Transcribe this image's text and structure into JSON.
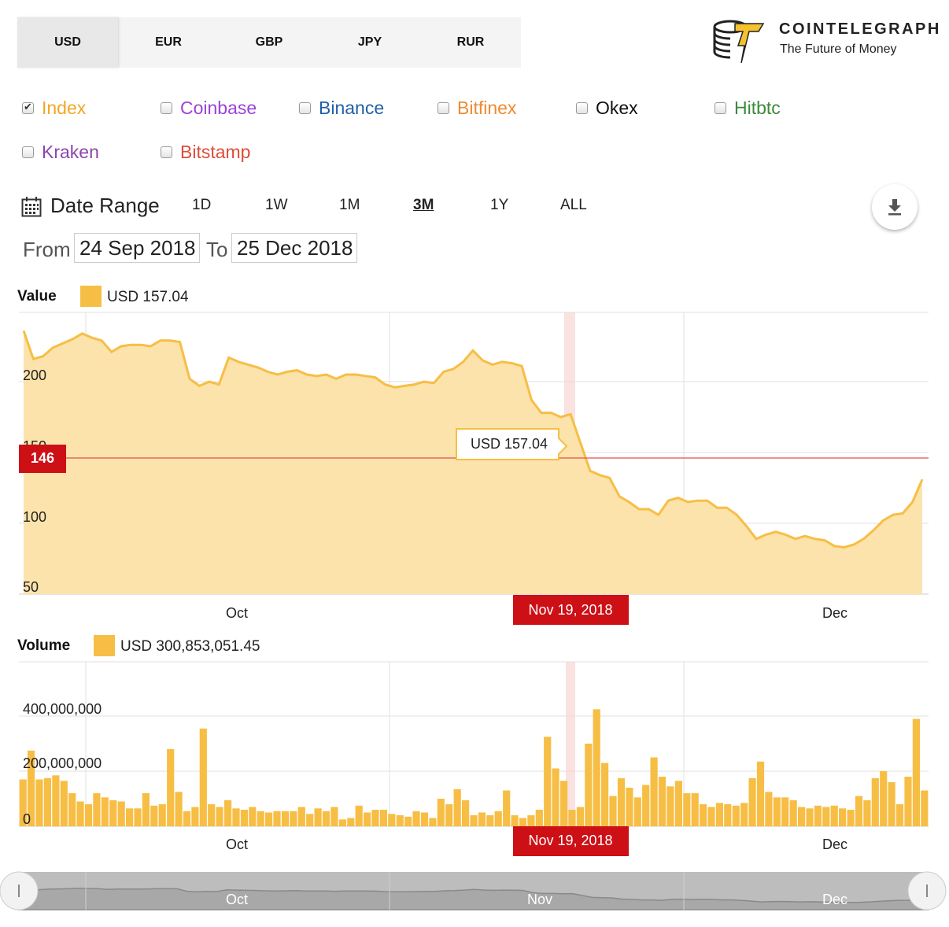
{
  "currencies": {
    "tabs": [
      "USD",
      "EUR",
      "GBP",
      "JPY",
      "RUR"
    ],
    "active": "USD"
  },
  "logo": {
    "title": "COINTELEGRAPH",
    "subtitle": "The Future of Money",
    "icon": "coin-stack-lightning-icon"
  },
  "exchanges": [
    {
      "label": "Index",
      "checked": true,
      "color": "#f5a623"
    },
    {
      "label": "Coinbase",
      "checked": false,
      "color": "#9b42d8"
    },
    {
      "label": "Binance",
      "checked": false,
      "color": "#1f5fa8"
    },
    {
      "label": "Bitfinex",
      "checked": false,
      "color": "#f08a30"
    },
    {
      "label": "Okex",
      "checked": false,
      "color": "#111111"
    },
    {
      "label": "Hitbtc",
      "checked": false,
      "color": "#3b8a3b"
    },
    {
      "label": "Kraken",
      "checked": false,
      "color": "#8e44ad"
    },
    {
      "label": "Bitstamp",
      "checked": false,
      "color": "#e04b3a"
    }
  ],
  "date_range": {
    "label": "Date Range",
    "buttons": [
      "1D",
      "1W",
      "1M",
      "3M",
      "1Y",
      "ALL"
    ],
    "active": "3M",
    "from_label": "From",
    "from_value": "24 Sep 2018",
    "to_label": "To",
    "to_value": "25 Dec 2018"
  },
  "value_legend": {
    "title": "Value",
    "text": "USD  157.04"
  },
  "volume_legend": {
    "title": "Volume",
    "text": "USD  300,853,051.45"
  },
  "colors": {
    "series": "#f7be45",
    "area_fill": "#fbe3ab",
    "marker_red": "#cc1016",
    "highlight_band": "#f7d5d3"
  },
  "chart_data": [
    {
      "type": "area",
      "title": "Value",
      "ylim": [
        50,
        250
      ],
      "y_ticks": [
        50,
        100,
        150,
        200
      ],
      "x_ticks": [
        "Oct",
        "Dec"
      ],
      "grid": true,
      "series": [
        {
          "name": "Index",
          "x": [
            "2018-09-24",
            "2018-09-25",
            "2018-09-26",
            "2018-09-27",
            "2018-09-28",
            "2018-09-29",
            "2018-09-30",
            "2018-10-01",
            "2018-10-02",
            "2018-10-03",
            "2018-10-04",
            "2018-10-05",
            "2018-10-06",
            "2018-10-07",
            "2018-10-08",
            "2018-10-09",
            "2018-10-10",
            "2018-10-11",
            "2018-10-12",
            "2018-10-13",
            "2018-10-14",
            "2018-10-15",
            "2018-10-16",
            "2018-10-17",
            "2018-10-18",
            "2018-10-19",
            "2018-10-20",
            "2018-10-21",
            "2018-10-22",
            "2018-10-23",
            "2018-10-24",
            "2018-10-25",
            "2018-10-26",
            "2018-10-27",
            "2018-10-28",
            "2018-10-29",
            "2018-10-30",
            "2018-10-31",
            "2018-11-01",
            "2018-11-02",
            "2018-11-03",
            "2018-11-04",
            "2018-11-05",
            "2018-11-06",
            "2018-11-07",
            "2018-11-08",
            "2018-11-09",
            "2018-11-10",
            "2018-11-11",
            "2018-11-12",
            "2018-11-13",
            "2018-11-14",
            "2018-11-15",
            "2018-11-16",
            "2018-11-17",
            "2018-11-18",
            "2018-11-19",
            "2018-11-20",
            "2018-11-21",
            "2018-11-22",
            "2018-11-23",
            "2018-11-24",
            "2018-11-25",
            "2018-11-26",
            "2018-11-27",
            "2018-11-28",
            "2018-11-29",
            "2018-11-30",
            "2018-12-01",
            "2018-12-02",
            "2018-12-03",
            "2018-12-04",
            "2018-12-05",
            "2018-12-06",
            "2018-12-07",
            "2018-12-08",
            "2018-12-09",
            "2018-12-10",
            "2018-12-11",
            "2018-12-12",
            "2018-12-13",
            "2018-12-14",
            "2018-12-15",
            "2018-12-16",
            "2018-12-17",
            "2018-12-18",
            "2018-12-19",
            "2018-12-20",
            "2018-12-21",
            "2018-12-22",
            "2018-12-23",
            "2018-12-24",
            "2018-12-25"
          ],
          "y": [
            236,
            216,
            218,
            224,
            227,
            230,
            234,
            231,
            229,
            221,
            225,
            226,
            226,
            225,
            229,
            229,
            228,
            202,
            197,
            200,
            198,
            217,
            214,
            212,
            210,
            207,
            205,
            207,
            208,
            205,
            204,
            205,
            202,
            205,
            205,
            204,
            203,
            198,
            196,
            197,
            198,
            200,
            199,
            207,
            209,
            214,
            222,
            215,
            212,
            214,
            213,
            211,
            187,
            178,
            178,
            175,
            177,
            157,
            137,
            134,
            132,
            119,
            115,
            110,
            110,
            106,
            116,
            118,
            115,
            116,
            116,
            111,
            111,
            106,
            98,
            89,
            92,
            94,
            92,
            89,
            91,
            89,
            88,
            84,
            83,
            85,
            89,
            95,
            102,
            106,
            107,
            115,
            131
          ]
        }
      ]
    },
    {
      "type": "bar",
      "title": "Volume",
      "ylim": [
        0,
        450000000
      ],
      "y_ticks": [
        0,
        200000000,
        400000000
      ],
      "x_ticks": [
        "Oct",
        "Dec"
      ],
      "grid": true,
      "series": [
        {
          "name": "Index",
          "values": [
            170000000,
            275000000,
            170000000,
            175000000,
            185000000,
            165000000,
            120000000,
            90000000,
            80000000,
            120000000,
            105000000,
            95000000,
            90000000,
            65000000,
            65000000,
            120000000,
            75000000,
            80000000,
            280000000,
            125000000,
            55000000,
            70000000,
            355000000,
            80000000,
            70000000,
            95000000,
            65000000,
            60000000,
            70000000,
            55000000,
            50000000,
            55000000,
            55000000,
            55000000,
            70000000,
            45000000,
            65000000,
            55000000,
            70000000,
            25000000,
            30000000,
            75000000,
            50000000,
            60000000,
            60000000,
            45000000,
            40000000,
            35000000,
            55000000,
            50000000,
            30000000,
            100000000,
            80000000,
            135000000,
            95000000,
            40000000,
            50000000,
            40000000,
            55000000,
            130000000,
            40000000,
            30000000,
            40000000,
            60000000,
            325000000,
            210000000,
            165000000,
            60000000,
            70000000,
            300000000,
            425000000,
            230000000,
            110000000,
            175000000,
            140000000,
            105000000,
            150000000,
            250000000,
            180000000,
            145000000,
            165000000,
            120000000,
            120000000,
            80000000,
            70000000,
            85000000,
            80000000,
            75000000,
            85000000,
            175000000,
            235000000,
            125000000,
            105000000,
            105000000,
            95000000,
            70000000,
            65000000,
            75000000,
            70000000,
            75000000,
            65000000,
            60000000,
            110000000,
            95000000,
            175000000,
            200000000,
            160000000,
            80000000,
            180000000,
            390000000,
            130000000
          ]
        }
      ]
    }
  ],
  "value_axis": {
    "tick_labels": [
      "200",
      "150",
      "100",
      "50"
    ],
    "current_marker": "146",
    "tooltip": "USD 157.04",
    "date_marker": "Nov 19, 2018",
    "x_labels": [
      "Oct",
      "Dec"
    ]
  },
  "volume_axis": {
    "tick_labels": [
      "400,000,000",
      "200,000,000",
      "0"
    ],
    "date_marker": "Nov 19, 2018",
    "x_labels": [
      "Oct",
      "Dec"
    ]
  },
  "navigator": {
    "labels": [
      "Oct",
      "Nov",
      "Dec"
    ]
  }
}
